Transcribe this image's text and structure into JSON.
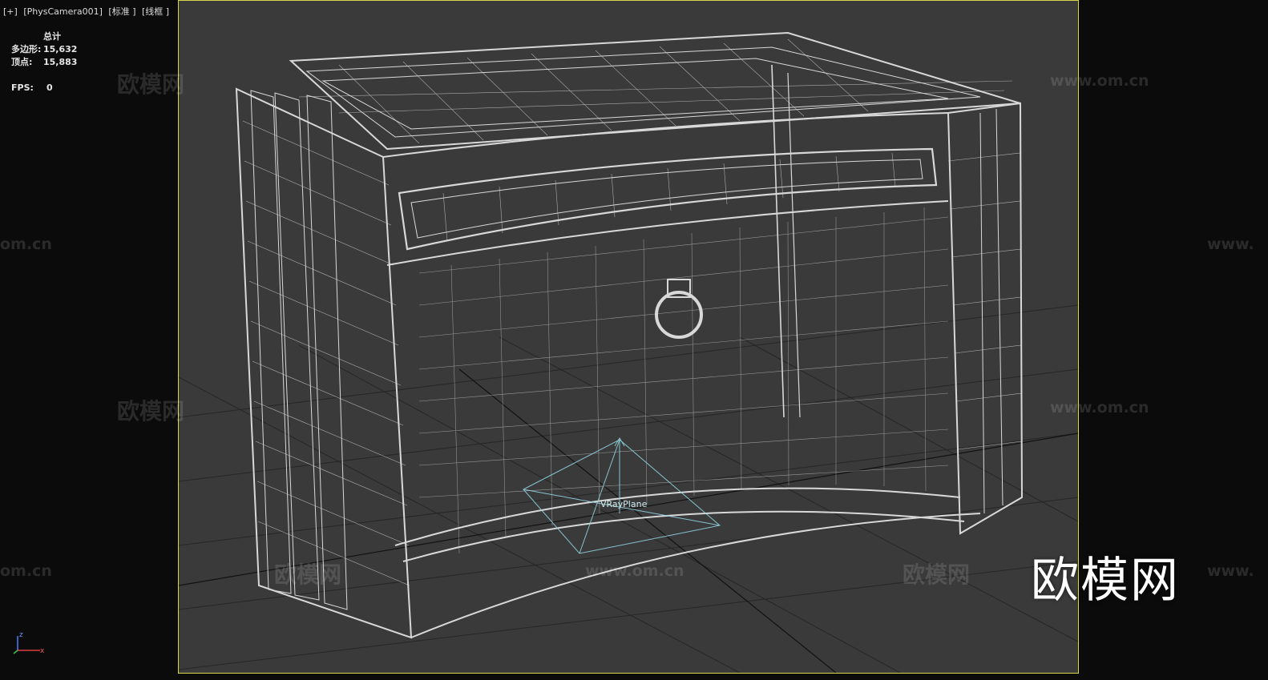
{
  "viewport_label": {
    "plus": "[+]",
    "camera": "[PhysCamera001]",
    "shading": "[标准 ]",
    "mode": "[线框 ]"
  },
  "stats": {
    "header": "总计",
    "polys_label": "多边形:",
    "polys_value": "15,632",
    "verts_label": "顶点:",
    "verts_value": "15,883",
    "fps_label": "FPS:",
    "fps_value": "0"
  },
  "helper": {
    "label": "VRayPlane"
  },
  "gizmo": {
    "z": "z",
    "x": "x"
  },
  "watermarks": {
    "cn": "欧模网",
    "url": "www.om.cn",
    "url_short": "om.cn",
    "url_prefix": "www."
  },
  "logo": {
    "text": "欧模网"
  },
  "colors": {
    "viewport_border": "#d8d84a",
    "viewport_bg": "#3a3a3a",
    "wire": "#d8d8d8",
    "helper": "#8fd3df",
    "panel_bg": "#0b0b0b"
  }
}
